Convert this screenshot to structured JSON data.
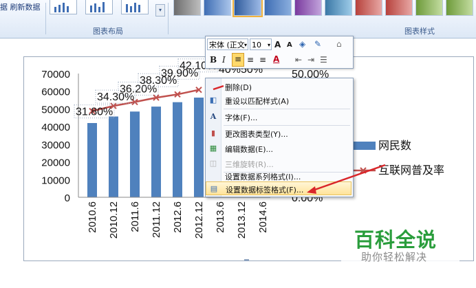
{
  "ribbon": {
    "refresh_label": "据 刷新数据",
    "groups": {
      "layout_label": "图表布局",
      "styles_label": "图表样式"
    },
    "style_colors": [
      "#7a7a7a",
      "#3f6eb4",
      "#3f6eb4",
      "#c0504d",
      "#9bbb59",
      "#8064a2",
      "#4bacc6"
    ]
  },
  "mini_toolbar": {
    "font_name": "宋体 (正文",
    "font_size": "10",
    "grow_font": "A",
    "shrink_font": "A",
    "bold": "B",
    "italic": "I",
    "font_color_label": "A"
  },
  "context_menu": {
    "items": [
      {
        "label": "删除(D)",
        "icon": "delete-icon",
        "enabled": true
      },
      {
        "label": "重设以匹配样式(A)",
        "icon": "reset-style-icon",
        "enabled": true
      },
      {
        "label": "字体(F)...",
        "icon": "font-icon",
        "enabled": true
      },
      {
        "label": "更改图表类型(Y)...",
        "icon": "chart-type-icon",
        "enabled": true
      },
      {
        "label": "编辑数据(E)...",
        "icon": "edit-data-icon",
        "enabled": true
      },
      {
        "label": "三维旋转(R)...",
        "icon": "rotate-3d-icon",
        "enabled": false
      },
      {
        "label": "设置数据系列格式(I)...",
        "icon": "",
        "enabled": true
      },
      {
        "label": "设置数据标签格式(F)...",
        "icon": "format-label-icon",
        "enabled": true,
        "highlighted": true
      }
    ]
  },
  "watermark": {
    "title": "百科全说",
    "subtitle": "助你轻松解决"
  },
  "chart_data": {
    "type": "bar",
    "categories": [
      "2010.6",
      "2010.12",
      "2011.6",
      "2011.12",
      "2012.6",
      "2012.12",
      "2013.6",
      "2013.12",
      "2014.6"
    ],
    "ylim": [
      0,
      70000
    ],
    "y_ticks": [
      "0",
      "10000",
      "20000",
      "30000",
      "40000",
      "50000",
      "60000",
      "70000"
    ],
    "y2_ticks": [
      "0.00%",
      "50.00%"
    ],
    "series": [
      {
        "name": "网民数",
        "type": "bar",
        "color": "#4f81bd",
        "values": [
          42000,
          45700,
          48500,
          51300,
          53800,
          56400,
          null,
          null,
          null
        ]
      },
      {
        "name": "互联网普及率",
        "type": "line",
        "color": "#c0504d",
        "values": [
          31.8,
          34.3,
          36.2,
          38.3,
          39.9,
          42.1,
          null,
          null,
          null
        ],
        "labels": [
          "31.80%",
          "34.30%",
          "36.20%",
          "38.30%",
          "39.90%",
          "42.10%"
        ]
      }
    ],
    "overlap_label": "40%50%",
    "legend_position": "right"
  }
}
